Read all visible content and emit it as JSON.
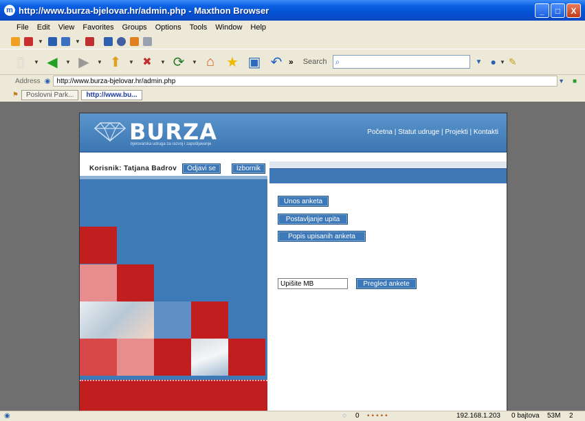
{
  "window": {
    "title": "http://www.burza-bjelovar.hr/admin.php - Maxthon Browser",
    "controls": [
      "_",
      "□",
      "X"
    ]
  },
  "menu": [
    "File",
    "Edit",
    "View",
    "Favorites",
    "Groups",
    "Options",
    "Tools",
    "Window",
    "Help"
  ],
  "toolbar": {
    "search_label": "Search",
    "overflow": "»"
  },
  "address": {
    "label": "Address",
    "url": "http://www.burza-bjelovar.hr/admin.php"
  },
  "tabs": [
    {
      "label": "Poslovni Park...",
      "active": false
    },
    {
      "label": "http://www.bu...",
      "active": true
    }
  ],
  "site": {
    "logo_text": "BURZA",
    "logo_sub": "bjelovarska udruga za razvoj i zapošljavanje",
    "nav": [
      "Početna",
      "Statut udruge",
      "Projekti",
      "Kontakti"
    ],
    "user_label": "Korisnik: Tatjana Badrov",
    "logout_label": "Odjavi se",
    "menu_label": "Izbornik",
    "actions": [
      "Unos anketa",
      "Postavljanje upita",
      "Popis upisanih anketa"
    ],
    "mb_input_value": "Upišite MB",
    "review_label": "Pregled ankete"
  },
  "status": {
    "counter": "0",
    "ip": "192.168.1.203",
    "bytes": "0 bajtova",
    "memory": "53M",
    "count": "2"
  },
  "colors": {
    "accent": "#3e78b6",
    "red": "#c11f1f",
    "viewport_bg": "#6f6f6f"
  }
}
